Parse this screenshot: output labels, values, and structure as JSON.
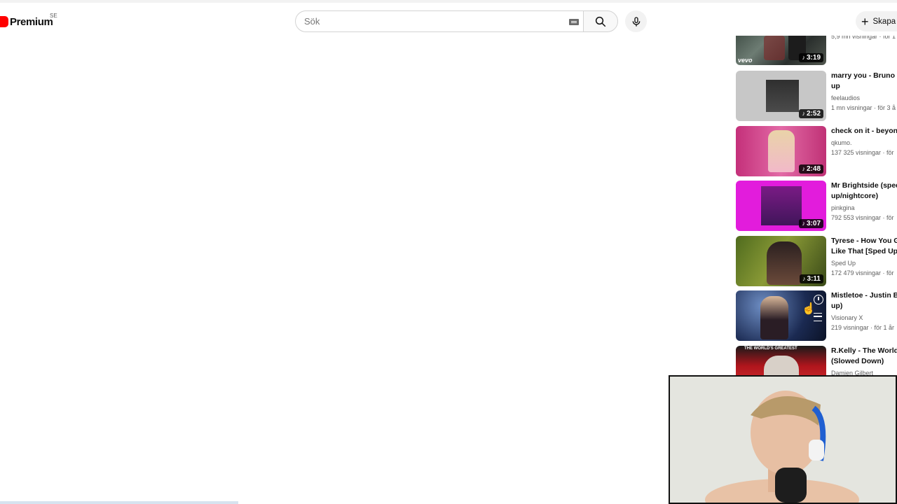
{
  "header": {
    "logo_text": "Premium",
    "logo_region": "SE",
    "search": {
      "placeholder": "Sök",
      "value": ""
    },
    "create_label": "Skapa"
  },
  "related_videos": [
    {
      "title": "",
      "channel": "",
      "stats": "5,9 mn visningar · för 1",
      "duration": "3:19",
      "badge": "vevo"
    },
    {
      "title": "marry you - Bruno M up",
      "channel": "feelaudios",
      "stats": "1 mn visningar · för 3 å",
      "duration": "2:52"
    },
    {
      "title": "check on it - beyonc",
      "channel": "qkumo.",
      "stats": "137 325 visningar · för",
      "duration": "2:48"
    },
    {
      "title": "Mr Brightside (sped up/nightcore)",
      "channel": "pinkgina",
      "stats": "792 553 visningar · för",
      "duration": "3:07"
    },
    {
      "title": "Tyrese - How You G Like That [Sped Up]",
      "channel": "Sped Up",
      "stats": "172 479 visningar · för",
      "duration": "3:11"
    },
    {
      "title": "Mistletoe - Justin B up)",
      "channel": "Visionary X",
      "stats": "219 visningar · för 1 år",
      "duration": ""
    },
    {
      "title": "R.Kelly - The World' (Slowed Down)",
      "channel": "Damien Gilbert",
      "stats": "",
      "duration": "",
      "thumb_text": "THE WORLD'S GREATEST"
    }
  ],
  "colors": {
    "brand_red": "#ff0000",
    "text_secondary": "#606060"
  },
  "icons": [
    "youtube-logo-icon",
    "keyboard-icon",
    "search-icon",
    "mic-icon",
    "plus-icon",
    "music-note-icon",
    "clock-icon",
    "queue-icon"
  ]
}
